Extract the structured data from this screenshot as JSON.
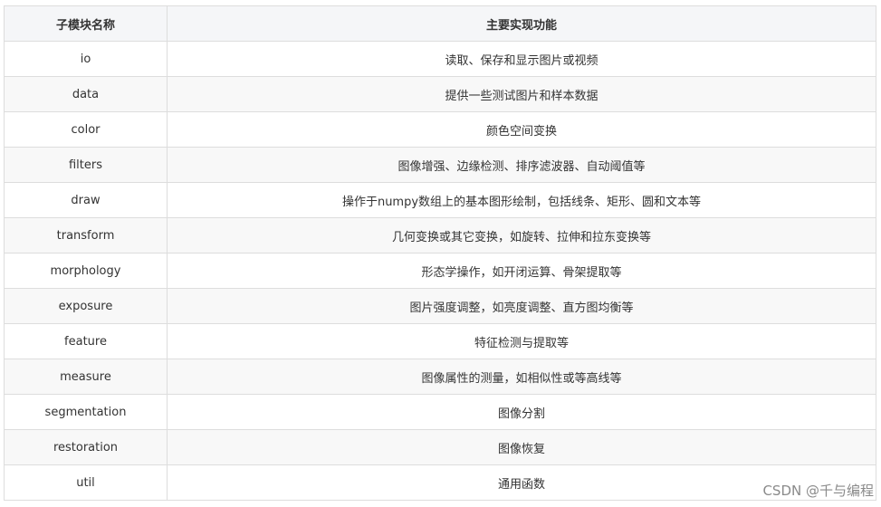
{
  "table": {
    "headers": [
      "子模块名称",
      "主要实现功能"
    ],
    "rows": [
      [
        "io",
        "读取、保存和显示图片或视频"
      ],
      [
        "data",
        "提供一些测试图片和样本数据"
      ],
      [
        "color",
        "颜色空间变换"
      ],
      [
        "filters",
        "图像增强、边缘检测、排序滤波器、自动阈值等"
      ],
      [
        "draw",
        "操作于numpy数组上的基本图形绘制，包括线条、矩形、圆和文本等"
      ],
      [
        "transform",
        "几何变换或其它变换，如旋转、拉伸和拉东变换等"
      ],
      [
        "morphology",
        "形态学操作，如开闭运算、骨架提取等"
      ],
      [
        "exposure",
        "图片强度调整，如亮度调整、直方图均衡等"
      ],
      [
        "feature",
        "特征检测与提取等"
      ],
      [
        "measure",
        "图像属性的测量，如相似性或等高线等"
      ],
      [
        "segmentation",
        "图像分割"
      ],
      [
        "restoration",
        "图像恢复"
      ],
      [
        "util",
        "通用函数"
      ]
    ]
  },
  "watermark": "CSDN @千与编程"
}
